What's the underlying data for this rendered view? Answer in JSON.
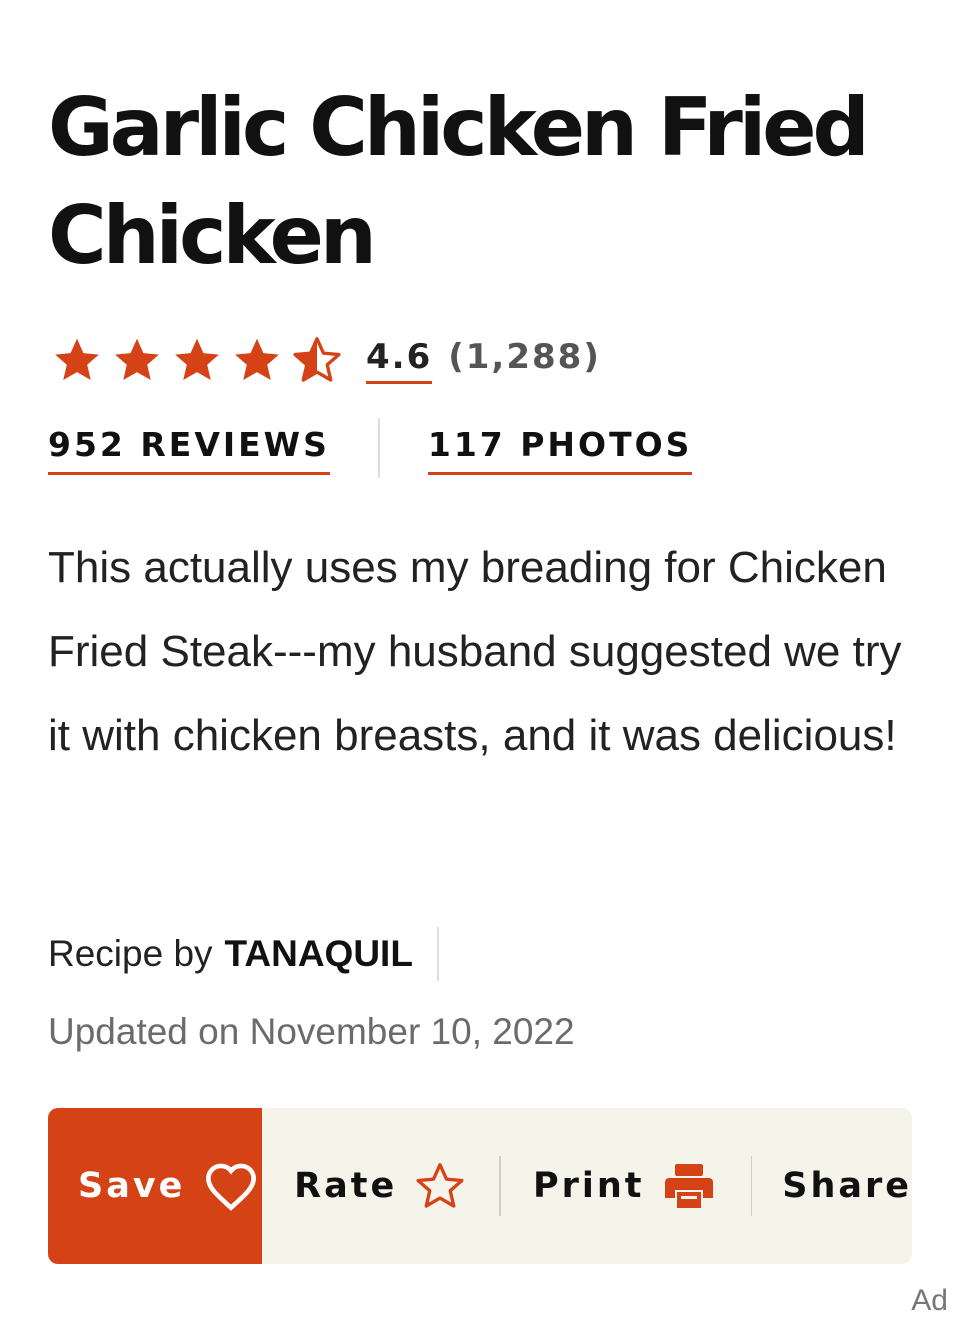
{
  "recipe": {
    "title": "Garlic Chicken Fried Chicken",
    "description": "This actually uses my breading for Chicken Fried Steak---my husband suggested we try it with chicken breasts, and it was delicious!"
  },
  "rating": {
    "value": "4.6",
    "count": "(1,288)",
    "stars_filled": 4,
    "stars_total": 5,
    "star_color": "#d54215"
  },
  "links": {
    "reviews": "952 REVIEWS",
    "photos": "117 PHOTOS"
  },
  "byline": {
    "label": "Recipe by",
    "author": "TANAQUIL",
    "updated": "Updated on November 10, 2022"
  },
  "actions": {
    "save": "Save",
    "rate": "Rate",
    "print": "Print",
    "share": "Share"
  },
  "ad": {
    "label": "Ad"
  },
  "colors": {
    "accent": "#d54215",
    "action_bar_bg": "#f4f4eb",
    "text": "#111111",
    "muted_text": "#6b6b6b"
  },
  "icons": [
    "star-icon",
    "half-star-icon",
    "heart-icon",
    "star-outline-icon",
    "printer-icon"
  ]
}
